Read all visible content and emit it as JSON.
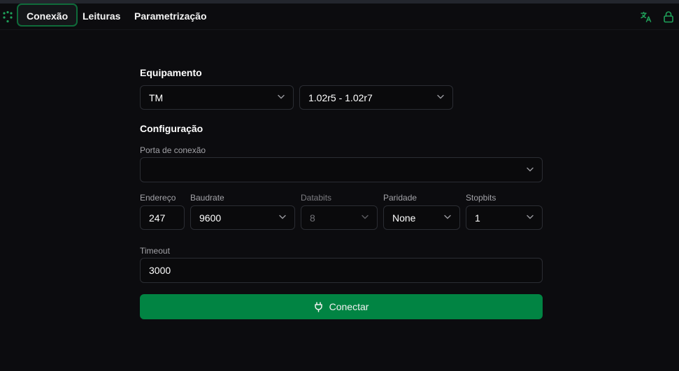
{
  "nav": {
    "tabs": [
      {
        "label": "Conexão",
        "active": true
      },
      {
        "label": "Leituras",
        "active": false
      },
      {
        "label": "Parametrização",
        "active": false
      }
    ],
    "icons": [
      "translate-icon",
      "lock-icon"
    ],
    "accent": "#1fa15a"
  },
  "equipamento": {
    "title": "Equipamento",
    "model": "TM",
    "version": "1.02r5 - 1.02r7"
  },
  "configuracao": {
    "title": "Configuração",
    "porta_label": "Porta de conexão",
    "porta_value": "",
    "endereco_label": "Endereço",
    "endereco_value": "247",
    "baudrate_label": "Baudrate",
    "baudrate_value": "9600",
    "databits_label": "Databits",
    "databits_value": "8",
    "paridade_label": "Paridade",
    "paridade_value": "None",
    "stopbits_label": "Stopbits",
    "stopbits_value": "1",
    "timeout_label": "Timeout",
    "timeout_value": "3000"
  },
  "connect_button": {
    "label": "Conectar",
    "color": "#018443"
  }
}
